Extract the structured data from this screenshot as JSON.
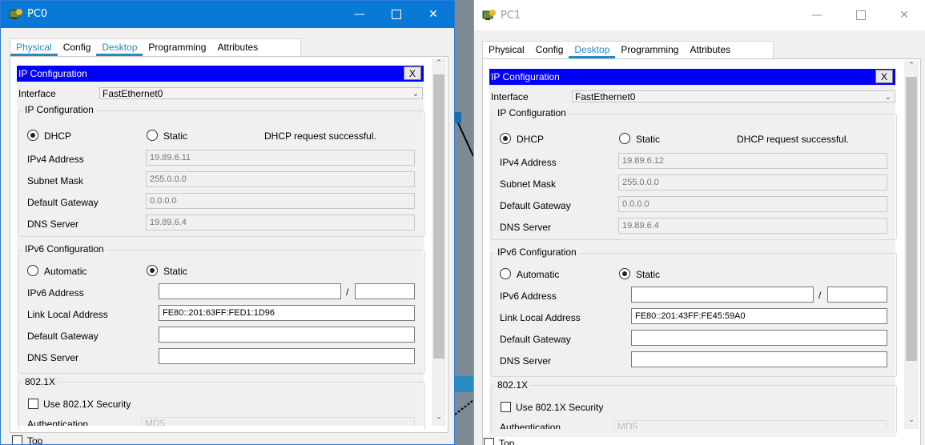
{
  "pc0": {
    "title": "PC0",
    "tabs": [
      "Physical",
      "Config",
      "Desktop",
      "Programming",
      "Attributes"
    ],
    "ip_header": "IP Configuration",
    "close_x": "X",
    "interface_label": "Interface",
    "interface_value": "FastEthernet0",
    "ipv4_group": "IP Configuration",
    "dhcp_label": "DHCP",
    "static_label": "Static",
    "dhcp_status": "DHCP request successful.",
    "ipv4_address_label": "IPv4 Address",
    "ipv4_address": "19.89.6.11",
    "subnet_label": "Subnet Mask",
    "subnet": "255.0.0.0",
    "gateway_label": "Default Gateway",
    "gateway": "0.0.0.0",
    "dns_label": "DNS Server",
    "dns": "19.89.6.4",
    "ipv6_group": "IPv6 Configuration",
    "automatic_label": "Automatic",
    "static6_label": "Static",
    "ipv6_address_label": "IPv6 Address",
    "ipv6_address": "",
    "ipv6_prefix": "",
    "slash": "/",
    "link_local_label": "Link Local Address",
    "link_local": "FE80::201:63FF:FED1:1D96",
    "gateway6_label": "Default Gateway",
    "dns6_label": "DNS Server",
    "dot1x_group": "802.1X",
    "use_dot1x": "Use 802.1X Security",
    "auth_label": "Authentication",
    "auth_value": "MD5",
    "top_label": "Top"
  },
  "pc1": {
    "title": "PC1",
    "tabs": [
      "Physical",
      "Config",
      "Desktop",
      "Programming",
      "Attributes"
    ],
    "ip_header": "IP Configuration",
    "close_x": "X",
    "interface_label": "Interface",
    "interface_value": "FastEthernet0",
    "ipv4_group": "IP Configuration",
    "dhcp_label": "DHCP",
    "static_label": "Static",
    "dhcp_status": "DHCP request successful.",
    "ipv4_address_label": "IPv4 Address",
    "ipv4_address": "19.89.6.12",
    "subnet_label": "Subnet Mask",
    "subnet": "255.0.0.0",
    "gateway_label": "Default Gateway",
    "gateway": "0.0.0.0",
    "dns_label": "DNS Server",
    "dns": "19.89.6.4",
    "ipv6_group": "IPv6 Configuration",
    "automatic_label": "Automatic",
    "static6_label": "Static",
    "ipv6_address_label": "IPv6 Address",
    "ipv6_address": "",
    "ipv6_prefix": "",
    "slash": "/",
    "link_local_label": "Link Local Address",
    "link_local": "FE80::201:43FF:FE45:59A0",
    "gateway6_label": "Default Gateway",
    "dns6_label": "DNS Server",
    "dot1x_group": "802.1X",
    "use_dot1x": "Use 802.1X Security",
    "auth_label": "Authentication",
    "auth_value": "MD5",
    "top_label": "Top"
  },
  "icons": {
    "pc0_title": "pc-icon",
    "pc1_title": "pc-icon",
    "minimize": "minimize-icon",
    "maximize": "maximize-icon",
    "close": "close-icon"
  },
  "colors": {
    "active_titlebar": "#0a78d7",
    "ip_header": "#0000ff",
    "active_tab": "#2a8ac0"
  }
}
